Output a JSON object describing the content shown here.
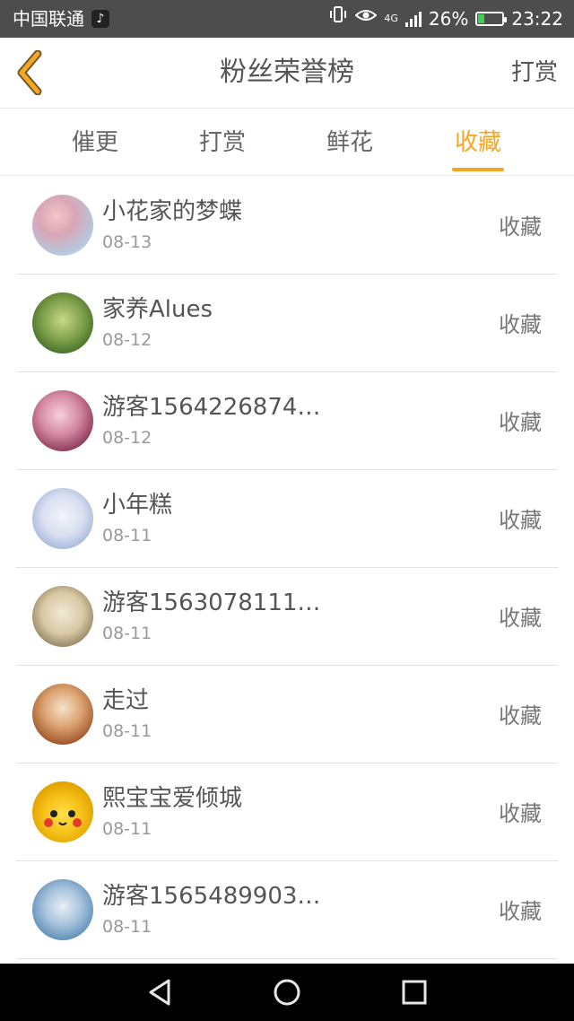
{
  "status_bar": {
    "carrier": "中国联通",
    "tiktok_badge": "♪",
    "network": "4G",
    "battery": "26%",
    "time": "23:22",
    "battery_level": 0.26,
    "battery_color": "#3cd14e"
  },
  "header": {
    "title": "粉丝荣誉榜",
    "right_action": "打赏",
    "back_icon": "chevron-left-icon",
    "back_icon_color": "#f5a623"
  },
  "tabs": [
    {
      "label": "催更",
      "active": false
    },
    {
      "label": "打赏",
      "active": false
    },
    {
      "label": "鲜花",
      "active": false
    },
    {
      "label": "收藏",
      "active": true
    }
  ],
  "accent_color": "#f5a623",
  "list": [
    {
      "name": "小花家的梦蝶",
      "date": "08-13",
      "action": "收藏"
    },
    {
      "name": "家养Alues",
      "date": "08-12",
      "action": "收藏"
    },
    {
      "name": "游客1564226874…",
      "date": "08-12",
      "action": "收藏"
    },
    {
      "name": "小年糕",
      "date": "08-11",
      "action": "收藏"
    },
    {
      "name": "游客1563078111…",
      "date": "08-11",
      "action": "收藏"
    },
    {
      "name": "走过",
      "date": "08-11",
      "action": "收藏"
    },
    {
      "name": "熙宝宝爱倾城",
      "date": "08-11",
      "action": "收藏"
    },
    {
      "name": "游客1565489903…",
      "date": "08-11",
      "action": "收藏"
    }
  ],
  "nav_bar": {
    "icons": [
      "back-triangle-icon",
      "home-circle-icon",
      "recents-square-icon"
    ]
  }
}
